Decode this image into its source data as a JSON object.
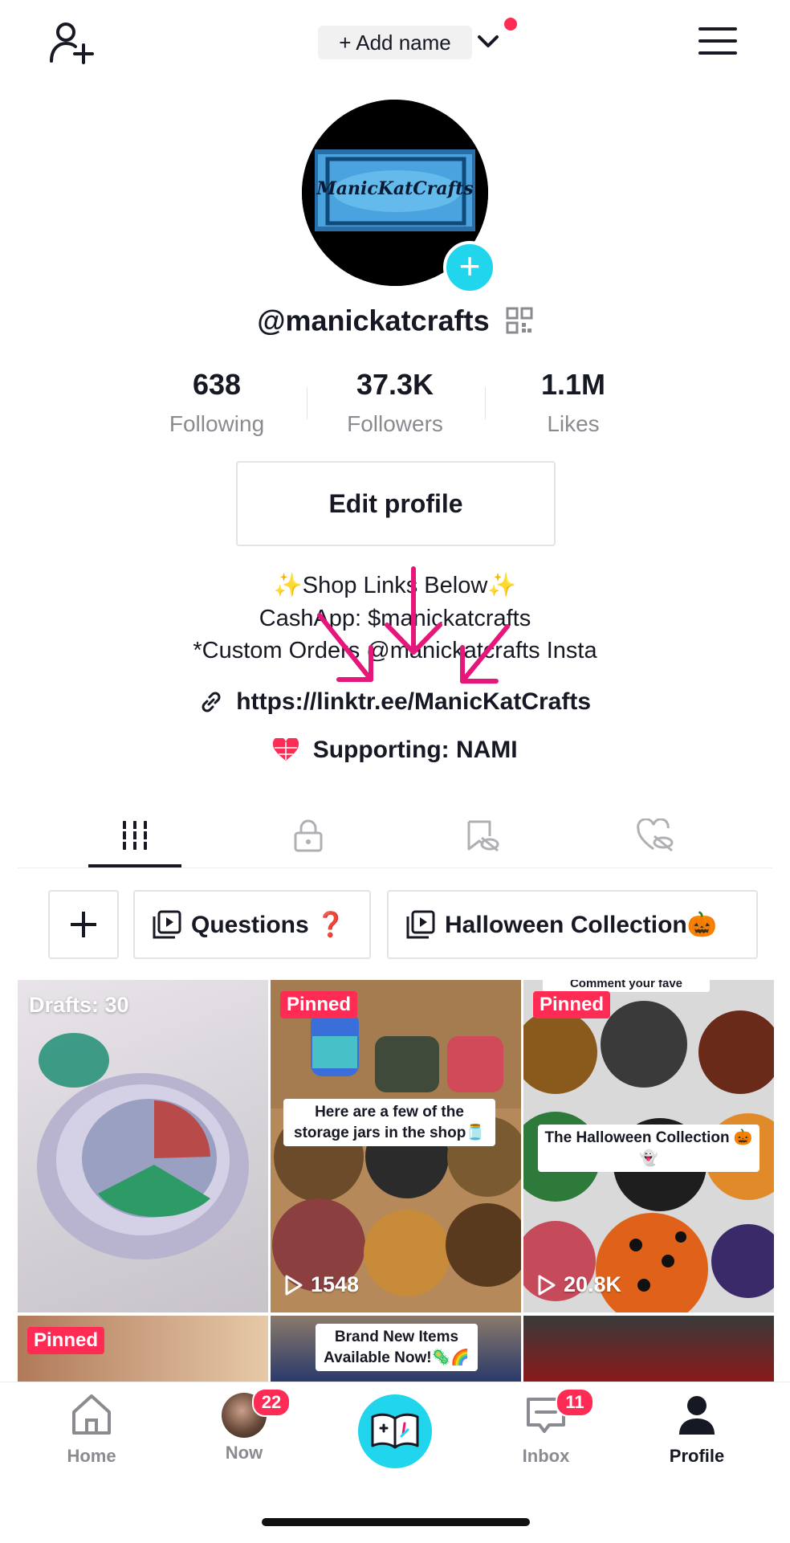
{
  "header": {
    "add_name_label": "+ Add name"
  },
  "profile": {
    "logo_text": "ManicKatCrafts",
    "username": "@manickatcrafts",
    "stats": [
      {
        "value": "638",
        "label": "Following"
      },
      {
        "value": "37.3K",
        "label": "Followers"
      },
      {
        "value": "1.1M",
        "label": "Likes"
      }
    ],
    "edit_label": "Edit profile",
    "bio": [
      "✨Shop Links Below✨",
      "CashApp: $manickatcrafts",
      "*Custom Orders @manickatcrafts Insta"
    ],
    "link": "https://linktr.ee/ManicKatCrafts",
    "supporting": "Supporting: NAMI"
  },
  "playlists": [
    {
      "label": "Questions ❓"
    },
    {
      "label": "Halloween Collection🎃"
    }
  ],
  "grid": {
    "drafts_label": "Drafts: 30",
    "pinned_label": "Pinned",
    "videos": [
      {
        "caption": "Here are a few of the storage jars in the shop🫙",
        "views": "1548"
      },
      {
        "caption": "The Halloween Collection 🎃👻",
        "caption_top": "Comment your fave",
        "views": "20.8K"
      },
      {
        "caption": "Brand New Items Available Now!🦠🌈"
      }
    ]
  },
  "nav": {
    "home": "Home",
    "now": "Now",
    "now_badge": "22",
    "inbox": "Inbox",
    "inbox_badge": "11",
    "profile": "Profile"
  },
  "colors": {
    "accent": "#fe2c55",
    "teal": "#20d5ec",
    "text": "#161823",
    "muted": "#8a8b91"
  }
}
